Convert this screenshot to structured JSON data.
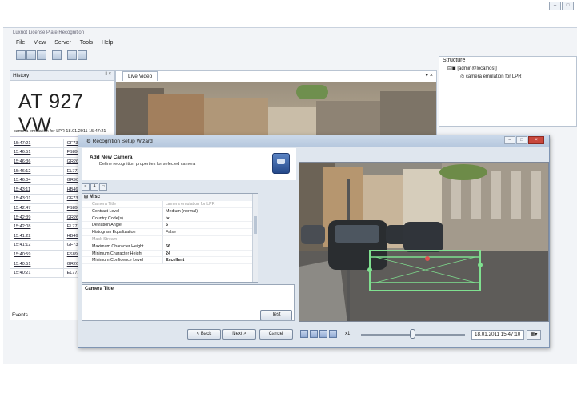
{
  "app": {
    "title": "Luxriot License Plate Recognition",
    "menu": [
      "File",
      "View",
      "Server",
      "Tools",
      "Help"
    ]
  },
  "history": {
    "panel_title": "History",
    "pin": "‖ ×",
    "plate": "AT 927 VW",
    "caption": "camera emulation for LPR   18.01.2011 15:47:21",
    "rows": [
      [
        "15:47:21",
        "GF7338"
      ],
      [
        "15:46:51",
        "FS8998"
      ],
      [
        "15:46:36",
        "GR267"
      ],
      [
        "15:46:12",
        "EL7722"
      ],
      [
        "15:46:04",
        "GR9047"
      ],
      [
        "15:43:11",
        "HB4647"
      ],
      [
        "15:43:01",
        "GF7338"
      ],
      [
        "15:42:47",
        "FS8998"
      ],
      [
        "15:42:39",
        "GR267"
      ],
      [
        "15:42:08",
        "EL7722"
      ],
      [
        "15:41:22",
        "HB4647"
      ],
      [
        "15:41:12",
        "GF7338"
      ],
      [
        "15:40:59",
        "FS8998"
      ],
      [
        "15:40:51",
        "GR267"
      ],
      [
        "15:40:21",
        "EL7722"
      ]
    ],
    "events_label": "Events"
  },
  "live": {
    "tab": "Live Video",
    "controls": "▾ ×"
  },
  "structure": {
    "title": "Structure",
    "server": "[admin@localhost]",
    "camera": "camera emulation for LPR"
  },
  "wizard": {
    "title": "Recognition Setup Wizard",
    "heading": "Add New Camera",
    "subheading": "Define recognition properties for selected camera",
    "category": "Misc",
    "properties": [
      {
        "k": "Camera Title",
        "v": "camera emulation for LPR",
        "style": "dim"
      },
      {
        "k": "Contrast Level",
        "v": "Medium (normal)",
        "style": ""
      },
      {
        "k": "Country Code(s)",
        "v": "lv",
        "style": "bold"
      },
      {
        "k": "Deviation Angle",
        "v": "6",
        "style": "bold"
      },
      {
        "k": "Histogram Equalization",
        "v": "False",
        "style": ""
      },
      {
        "k": "Mask Stream",
        "v": "",
        "style": "dim"
      },
      {
        "k": "Maximum Character Height",
        "v": "56",
        "style": "bold"
      },
      {
        "k": "Minimum Character Height",
        "v": "24",
        "style": "bold"
      },
      {
        "k": "Minimum Confidence Level",
        "v": "Excellent",
        "style": "bold"
      }
    ],
    "desc_title": "Camera Title",
    "test_label": "Test",
    "back_label": "< Back",
    "next_label": "Next >",
    "cancel_label": "Cancel",
    "speed": "x1",
    "datetime": "18.01.2011 15:47:10"
  }
}
